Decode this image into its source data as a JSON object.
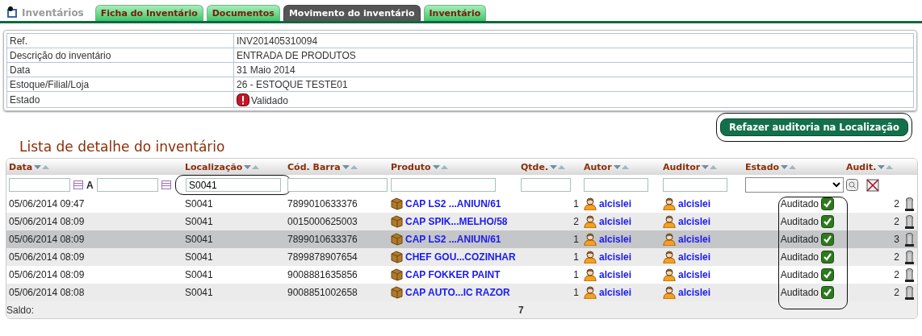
{
  "section_title": "Inventários",
  "tabs": [
    {
      "label": "Ficha do Inventário",
      "selected": false
    },
    {
      "label": "Documentos",
      "selected": false
    },
    {
      "label": "Movimento do inventário",
      "selected": true
    },
    {
      "label": "Inventário",
      "selected": false
    }
  ],
  "info": [
    {
      "label": "Ref.",
      "value": "INV201405310094"
    },
    {
      "label": "Descrição do inventário",
      "value": "ENTRADA DE PRODUTOS"
    },
    {
      "label": "Data",
      "value": "31 Maio 2014"
    },
    {
      "label": "Estoque/Filial/Loja",
      "value": "26 - ESTOQUE TESTE01"
    },
    {
      "label": "Estado",
      "value": "Validado",
      "kind": "status"
    }
  ],
  "action_button": {
    "label": "Refazer auditoria na Localização",
    "highlighted": true
  },
  "list_title": "Lista de detalhe do inventário",
  "table": {
    "columns": [
      {
        "label": "Data"
      },
      {
        "label": "Localização"
      },
      {
        "label": "Cód. Barra"
      },
      {
        "label": "Produto"
      },
      {
        "label": "Qtde."
      },
      {
        "label": "Autor"
      },
      {
        "label": "Auditor"
      },
      {
        "label": "Estado",
        "highlighted": true
      },
      {
        "label": "Audit."
      }
    ],
    "filters": {
      "date_separator": "A",
      "location": {
        "value": "S0041",
        "highlighted": true
      }
    },
    "rows": [
      {
        "date": "05/06/2014 09:47",
        "location": "S0041",
        "barcode": "7899010633376",
        "product": "CAP LS2 ...ANIUN/61",
        "qty": "1",
        "author": "alcislei",
        "auditor": "alcislei",
        "status": "Auditado",
        "audits": "2",
        "selected": false
      },
      {
        "date": "05/06/2014 08:09",
        "location": "S0041",
        "barcode": "0015000625003",
        "product": "CAP SPIK...MELHO/58",
        "qty": "2",
        "author": "alcislei",
        "auditor": "alcislei",
        "status": "Auditado",
        "audits": "2",
        "selected": false
      },
      {
        "date": "05/06/2014 08:09",
        "location": "S0041",
        "barcode": "7899010633376",
        "product": "CAP LS2 ...ANIUN/61",
        "qty": "1",
        "author": "alcislei",
        "auditor": "alcislei",
        "status": "Auditado",
        "audits": "3",
        "selected": true
      },
      {
        "date": "05/06/2014 08:09",
        "location": "S0041",
        "barcode": "7899878907654",
        "product": "CHEF GOU...COZINHAR",
        "qty": "1",
        "author": "alcislei",
        "auditor": "alcislei",
        "status": "Auditado",
        "audits": "2",
        "selected": false
      },
      {
        "date": "05/06/2014 08:09",
        "location": "S0041",
        "barcode": "9008881635856",
        "product": "CAP FOKKER PAINT",
        "qty": "1",
        "author": "alcislei",
        "auditor": "alcislei",
        "status": "Auditado",
        "audits": "2",
        "selected": false
      },
      {
        "date": "05/06/2014 08:08",
        "location": "S0041",
        "barcode": "9008851002658",
        "product": "CAP AUTO...IC RAZOR",
        "qty": "1",
        "author": "alcislei",
        "auditor": "alcislei",
        "status": "Auditado",
        "audits": "2",
        "selected": false
      }
    ],
    "footer": {
      "label": "Saldo:",
      "qty_total": "7"
    }
  }
}
